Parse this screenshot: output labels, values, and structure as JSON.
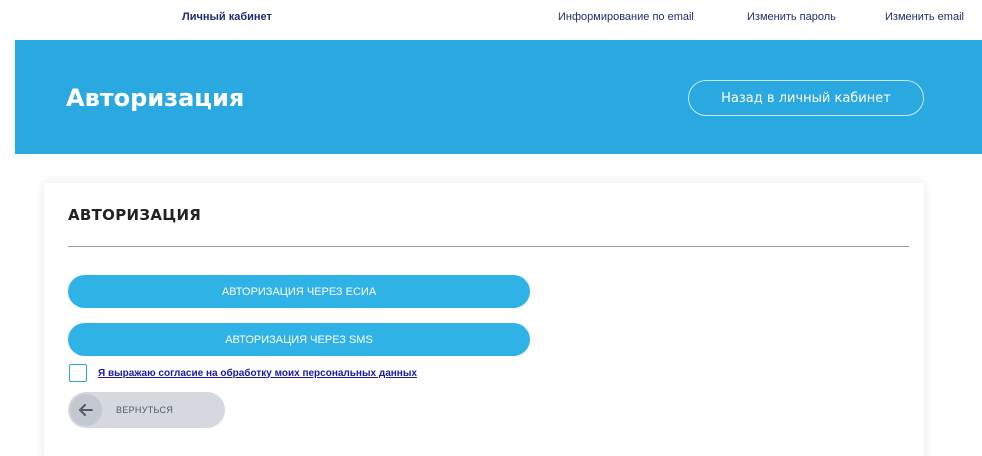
{
  "nav": {
    "cabinet": "Личный кабинет",
    "email_info": "Информирование по email",
    "change_password": "Изменить пароль",
    "change_email": "Изменить email"
  },
  "banner": {
    "title": "Авторизация",
    "back_button": "Назад в личный кабинет",
    "background_color": "#2aa8e0"
  },
  "card": {
    "title": "АВТОРИЗАЦИЯ",
    "esia_button": "АВТОРИЗАЦИЯ ЧЕРЕЗ ЕСИА",
    "sms_button": "АВТОРИЗАЦИЯ ЧЕРЕЗ SMS",
    "consent_checked": false,
    "consent_link": "Я выражаю согласие на обработку моих персональных данных",
    "return_button": "ВЕРНУТЬСЯ",
    "return_icon": "arrow-left-icon",
    "button_color": "#2fb3e6"
  }
}
